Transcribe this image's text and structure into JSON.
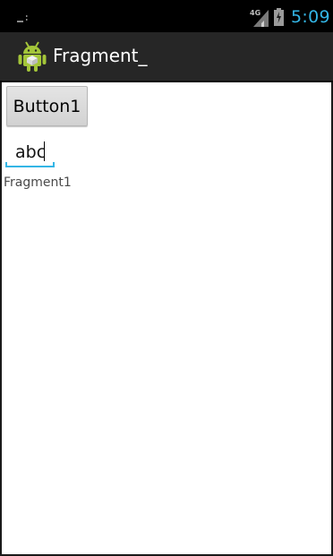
{
  "status_bar": {
    "network_type": "4G",
    "time": "5:09",
    "left_icon": "notification-icon",
    "signal_icon": "signal-icon",
    "battery_icon": "battery-charging-icon",
    "time_color": "#33b5e5"
  },
  "action_bar": {
    "app_icon": "android-icon",
    "title": "Fragment_"
  },
  "content": {
    "button1_label": "Button1",
    "edit_text_value": "abc",
    "fragment_label": "Fragment1",
    "accent_color": "#33b5e5"
  }
}
